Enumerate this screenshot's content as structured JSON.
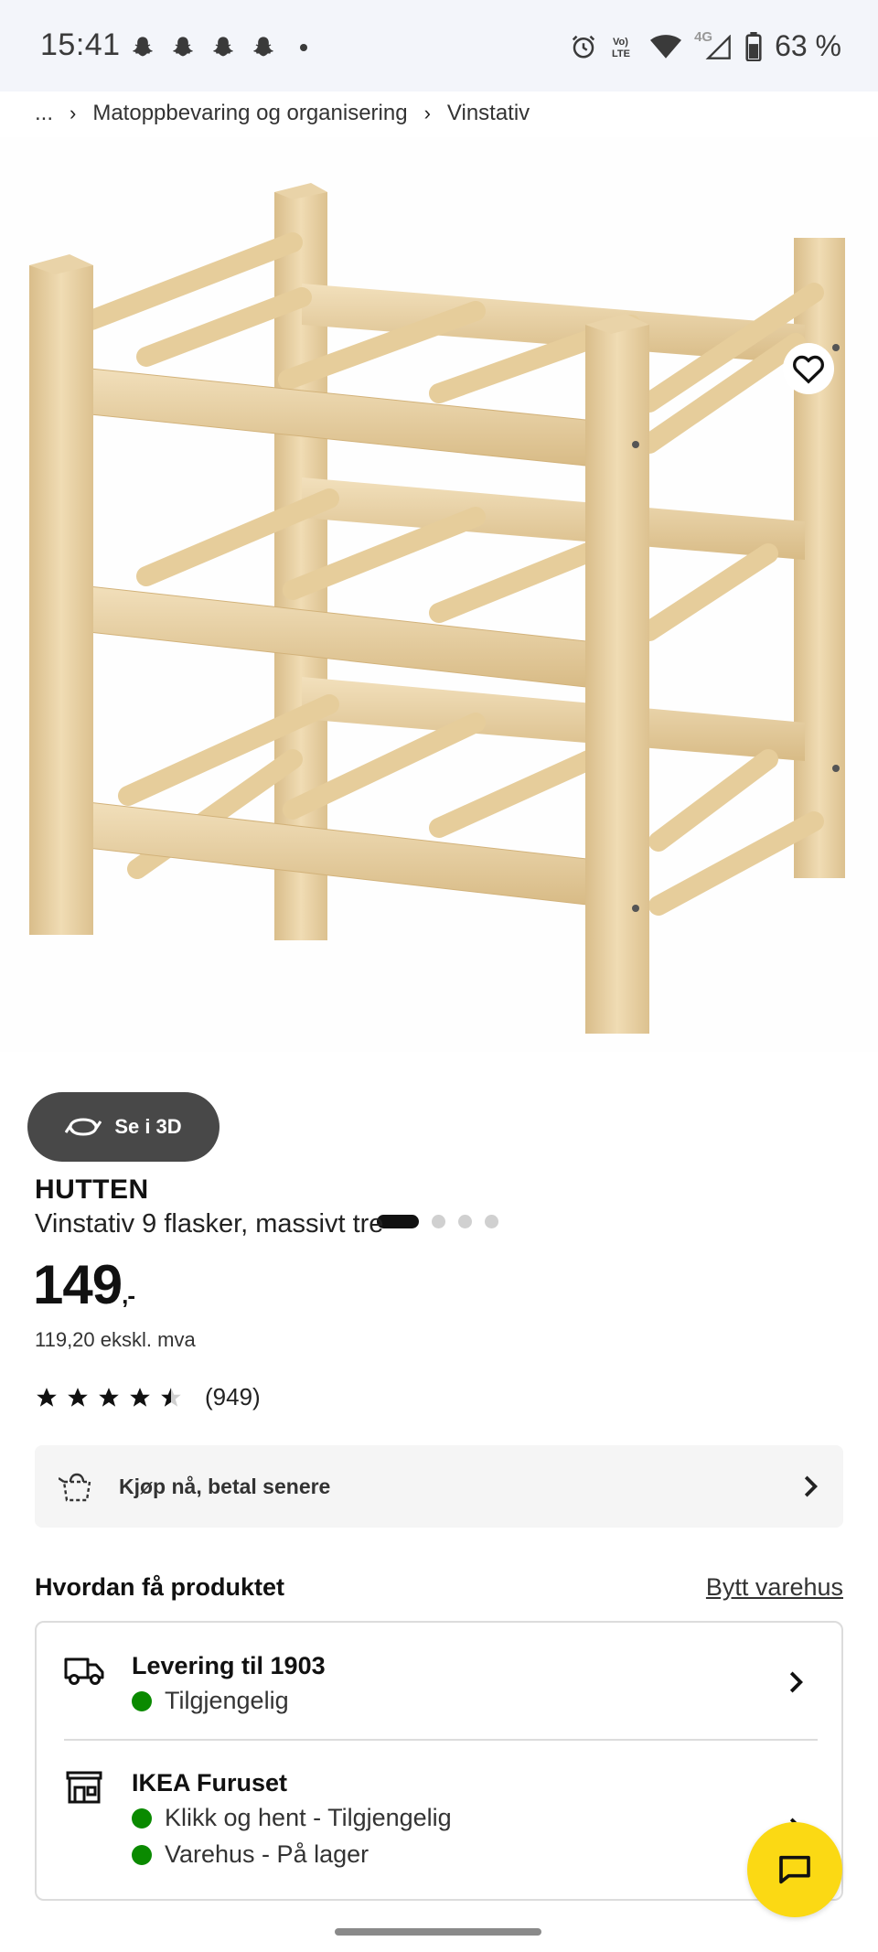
{
  "status_bar": {
    "time": "15:41",
    "battery": "63 %",
    "icons": [
      "snapchat-icon",
      "snapchat-icon",
      "snapchat-icon",
      "snapchat-icon",
      "dot",
      "alarm-icon",
      "volte-icon",
      "wifi-icon",
      "4g-signal-icon",
      "battery-icon"
    ],
    "network_label": "4G",
    "volte_top": "Vo)",
    "volte_bottom": "LTE"
  },
  "breadcrumb": {
    "ellipsis": "...",
    "items": [
      "Matoppbevaring og organisering",
      "Vinstativ"
    ]
  },
  "gallery": {
    "see_3d_label": "Se i 3D",
    "image_count": 4,
    "active_index": 0
  },
  "product": {
    "name": "HUTTEN",
    "description": "Vinstativ 9 flasker, massivt tre",
    "price": "149",
    "price_suffix": ",-",
    "price_ex_vat": "119,20 ekskl. mva",
    "rating": 4.5,
    "rating_max": 5,
    "review_count": "(949)"
  },
  "pay_later": {
    "label": "Kjøp nå, betal senere"
  },
  "delivery_section": {
    "title": "Hvordan få produktet",
    "change_store": "Bytt varehus",
    "delivery": {
      "title": "Levering til 1903",
      "status": "Tilgjengelig"
    },
    "store": {
      "title": "IKEA Furuset",
      "click_collect": "Klikk og hent - Tilgjengelig",
      "in_store": "Varehus - På lager"
    }
  },
  "colors": {
    "accent_yellow": "#fbd914",
    "available_green": "#0a8a00",
    "button_dark": "#484848",
    "wood": "#e8cfa0"
  }
}
